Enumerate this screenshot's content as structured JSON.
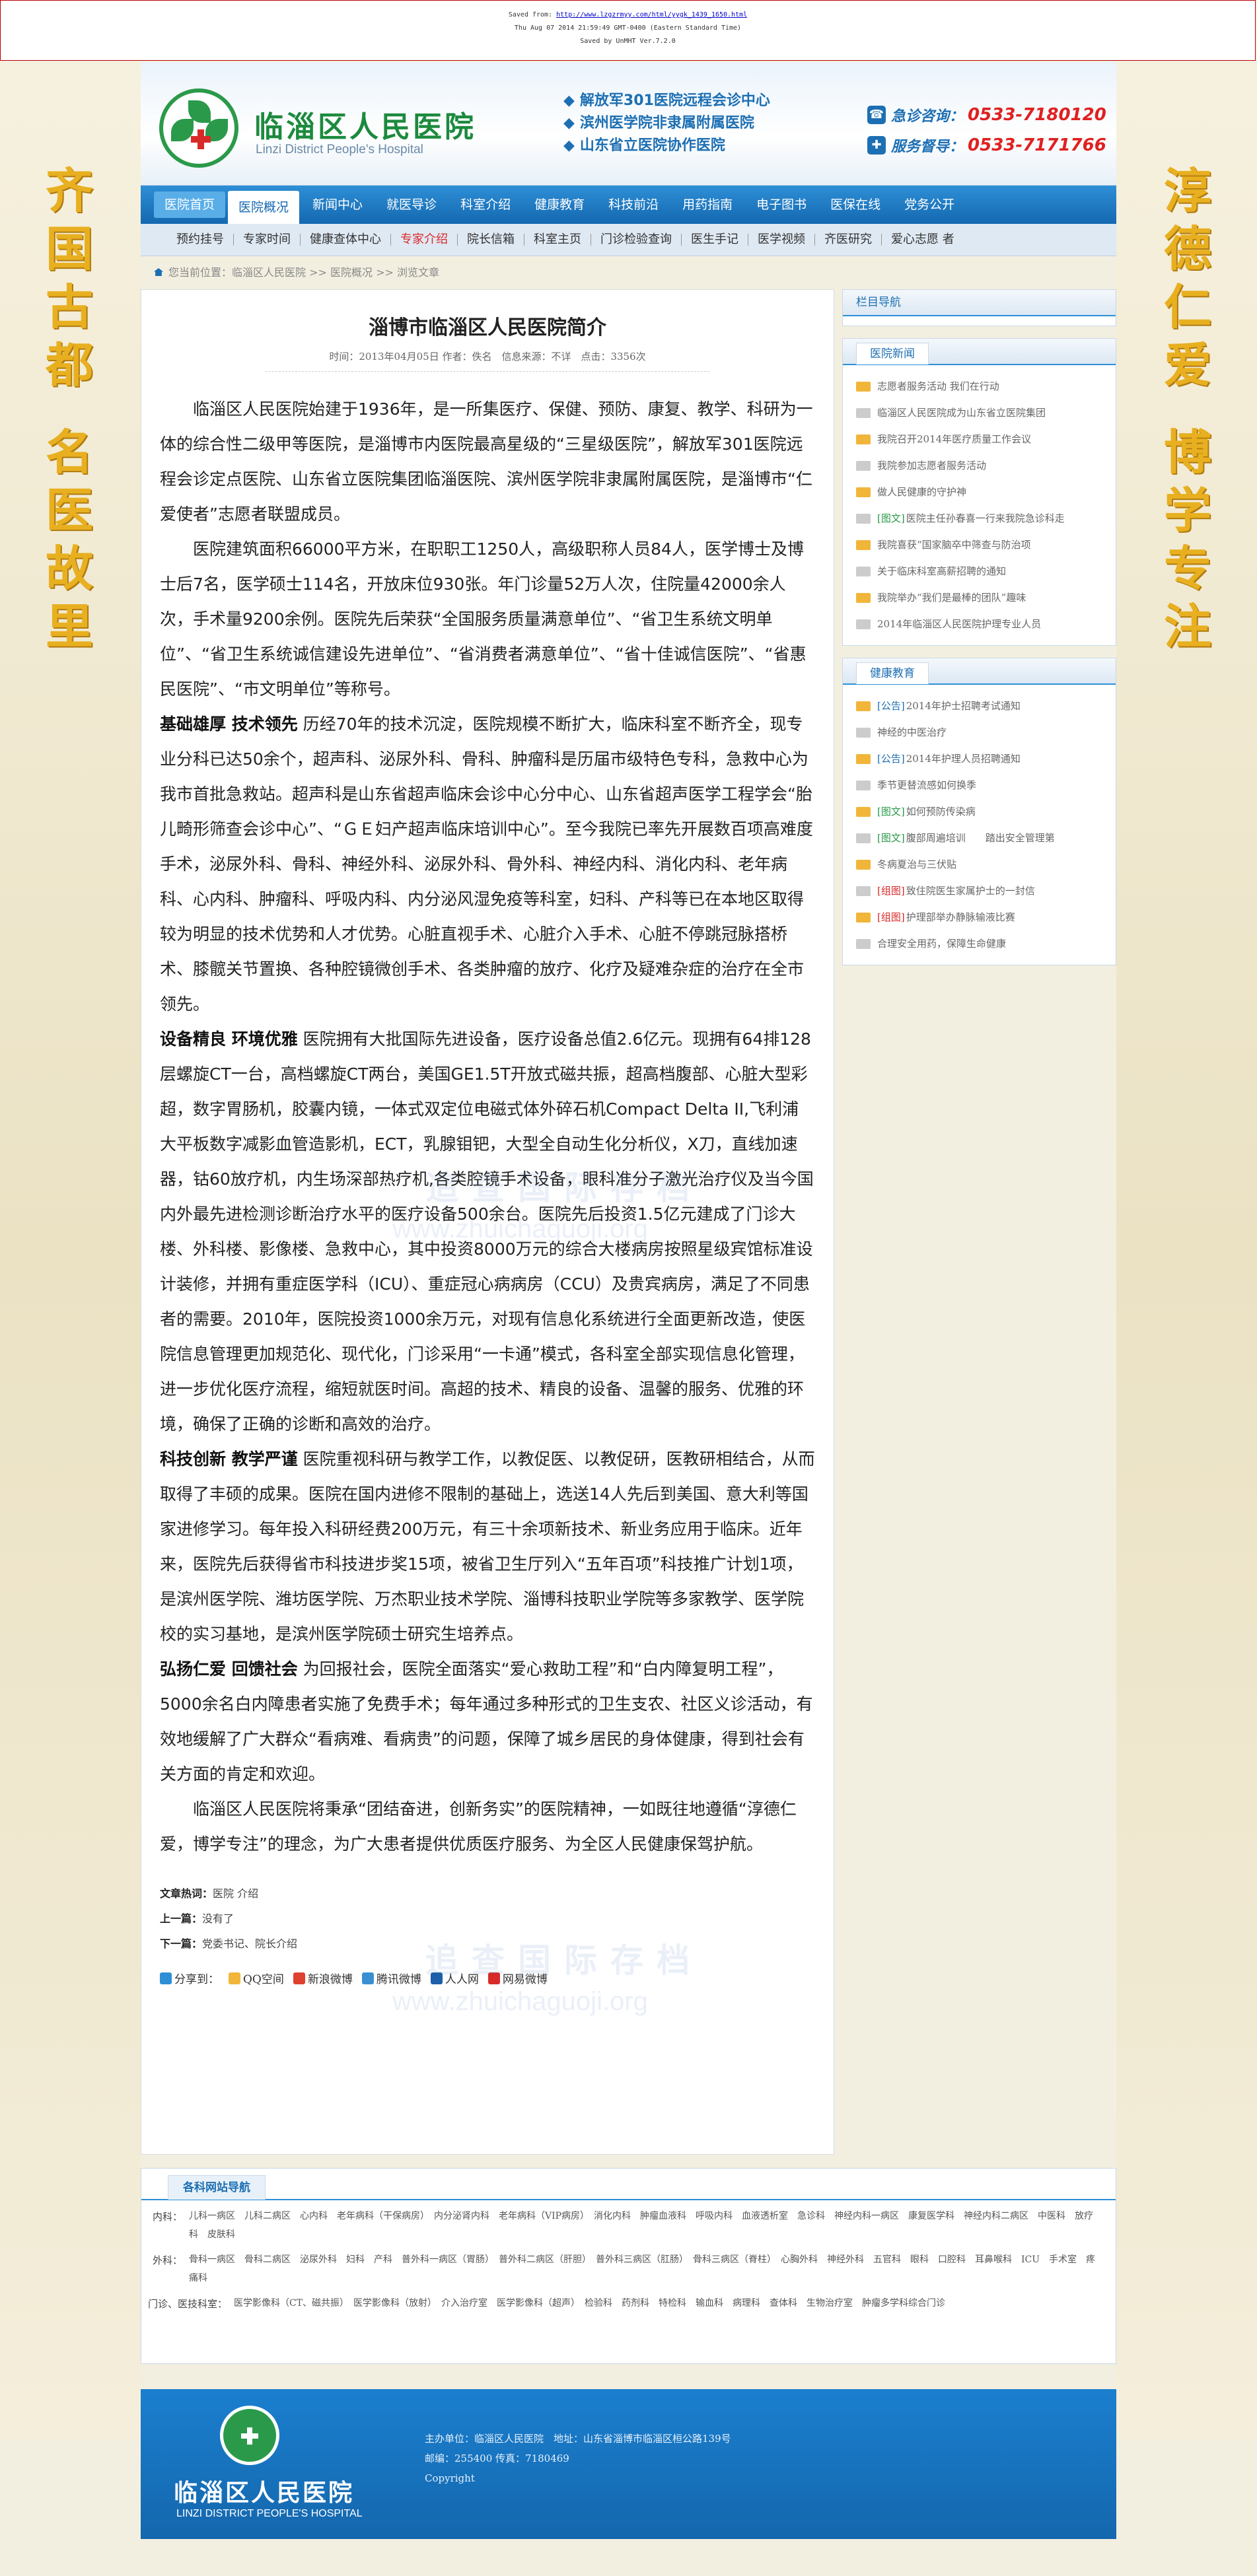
{
  "saved": {
    "line1_prefix": "Saved from",
    "line1_url": "http://www.lzgzrmyy.com/html/yygk_1439_1650.html",
    "line2": "Thu Aug 07 2014 21:59:49 GMT-0400 (Eastern Standard Time)",
    "line3": "Saved by UnMHT Ver.7.2.0"
  },
  "side": {
    "left_top": [
      "齐",
      "国",
      "古",
      "都"
    ],
    "left_bottom": [
      "名",
      "医",
      "故",
      "里"
    ],
    "right_top": [
      "淳",
      "德",
      "仁",
      "爱"
    ],
    "right_bottom": [
      "博",
      "学",
      "专",
      "注"
    ]
  },
  "header": {
    "title": "临淄区人民医院",
    "subtitle": "Linzi District People's Hospital",
    "links": [
      "解放军301医院远程会诊中心",
      "滨州医学院非隶属附属医院",
      "山东省立医院协作医院"
    ],
    "phone1_label": "急诊咨询：",
    "phone1_prefix": "0533-",
    "phone1_num": "7180120",
    "phone2_label": "服务督导：",
    "phone2_prefix": "0533-",
    "phone2_num": "7171766"
  },
  "nav1": [
    "医院首页",
    "医院概况",
    "新闻中心",
    "就医导诊",
    "科室介绍",
    "健康教育",
    "科技前沿",
    "用药指南",
    "电子图书",
    "医保在线",
    "党务公开"
  ],
  "nav2": [
    "预约挂号",
    "专家时间",
    "健康查体中心",
    "专家介绍",
    "院长信箱",
    "科室主页",
    "门诊检验查询",
    "医生手记",
    "医学视频",
    "齐医研究",
    "爱心志愿 者"
  ],
  "breadcrumb": {
    "text": "您当前位置：临淄区人民医院 >> 医院概况 >> 浏览文章"
  },
  "article": {
    "title": "淄博市临淄区人民医院简介",
    "meta": "时间：2013年04月05日 作者：佚名　信息来源：不详　点击：3356次",
    "p1": "临淄区人民医院始建于1936年，是一所集医疗、保健、预防、康复、教学、科研为一体的综合性二级甲等医院，是淄博市内医院最高星级的“三星级医院”，解放军301医院远程会诊定点医院、山东省立医院集团临淄医院、滨州医学院非隶属附属医院，是淄博市“仁爱使者”志愿者联盟成员。",
    "p2": "医院建筑面积66000平方米，在职职工1250人，高级职称人员84人，医学博士及博士后7名，医学硕士114名，开放床位930张。年门诊量52万人次，住院量42000余人次，手术量9200余例。医院先后荣获“全国服务质量满意单位”、“省卫生系统文明单位”、“省卫生系统诚信建设先进单位”、“省消费者满意单位”、“省十佳诚信医院”、“省惠民医院”、“市文明单位”等称号。",
    "h3": "基础雄厚 技术领先",
    "p3": "历经70年的技术沉淀，医院规模不断扩大，临床科室不断齐全，现专业分科已达50余个，超声科、泌尿外科、骨科、肿瘤科是历届市级特色专科，急救中心为我市首批急救站。超声科是山东省超声临床会诊中心分中心、山东省超声医学工程学会“胎儿畸形筛查会诊中心”、“ＧＥ妇产超声临床培训中心”。至今我院已率先开展数百项高难度手术，泌尿外科、骨科、神经外科、泌尿外科、骨外科、神经内科、消化内科、老年病科、心内科、肿瘤科、呼吸内科、内分泌风湿免疫等科室，妇科、产科等已在本地区取得较为明显的技术优势和人才优势。心脏直视手术、心脏介入手术、心脏不停跳冠脉搭桥术、膝髋关节置换、各种腔镜微创手术、各类肿瘤的放疗、化疗及疑难杂症的治疗在全市领先。",
    "h4": "设备精良 环境优雅",
    "p4": "医院拥有大批国际先进设备，医疗设备总值2.6亿元。现拥有64排128层螺旋CT一台，高档螺旋CT两台，美国GE1.5T开放式磁共振，超高档腹部、心脏大型彩超，数字胃肠机，胶囊内镜，一体式双定位电磁式体外碎石机Compact Delta II,飞利浦大平板数字减影血管造影机，ECT，乳腺钼钯，大型全自动生化分析仪，X刀，直线加速器，钴60放疗机，内生场深部热疗机,各类腔镜手术设备，眼科准分子激光治疗仪及当今国内外最先进检测诊断治疗水平的医疗设备500余台。医院先后投资1.5亿元建成了门诊大楼、外科楼、影像楼、急救中心，其中投资8000万元的综合大楼病房按照星级宾馆标准设计装修，并拥有重症医学科（ICU）、重症冠心病病房（CCU）及贵宾病房，满足了不同患者的需要。2010年，医院投资1000余万元，对现有信息化系统进行全面更新改造，使医院信息管理更加规范化、现代化，门诊采用“一卡通”模式，各科室全部实现信息化管理，进一步优化医疗流程，缩短就医时间。高超的技术、精良的设备、温馨的服务、优雅的环境，确保了正确的诊断和高效的治疗。",
    "h5": "科技创新 教学严谨",
    "p5": "医院重视科研与教学工作，以教促医、以教促研，医教研相结合，从而取得了丰硕的成果。医院在国内进修不限制的基础上，选送14人先后到美国、意大利等国家进修学习。每年投入科研经费200万元，有三十余项新技术、新业务应用于临床。近年来，医院先后获得省市科技进步奖15项，被省卫生厅列入“五年百项”科技推广计划1项，是滨州医学院、潍坊医学院、万杰职业技术学院、淄博科技职业学院等多家教学、医学院校的实习基地，是滨州医学院硕士研究生培养点。",
    "h6": "弘扬仁爱 回馈社会",
    "p6": "为回报社会，医院全面落实“爱心救助工程”和“白内障复明工程”，5000余名白内障患者实施了免费手术；每年通过多种形式的卫生支农、社区义诊活动，有效地缓解了广大群众“看病难、看病贵”的问题，保障了城乡居民的身体健康，得到社会有关方面的肯定和欢迎。",
    "p7": "临淄区人民医院将秉承“团结奋进，创新务实”的医院精神，一如既往地遵循“淳德仁爱，博学专注”的理念，为广大患者提供优质医疗服务、为全区人民健康保驾护航。",
    "watermark_cn": "追查国际存档",
    "watermark_url": "www.zhuichaguoji.org",
    "tags_label": "文章热词：",
    "tags": "医院 介绍",
    "prev_label": "上一篇：",
    "prev": "没有了",
    "next_label": "下一篇：",
    "next": "党委书记、院长介绍",
    "share_label": "分享到：",
    "share": [
      "QQ空间",
      "新浪微博",
      "腾讯微博",
      "人人网",
      "网易微博"
    ]
  },
  "sidebar": {
    "nav_title": "栏目导航",
    "news_title": "医院新闻",
    "news": [
      {
        "tag": "",
        "text": "志愿者服务活动 我们在行动"
      },
      {
        "tag": "",
        "text": "临淄区人民医院成为山东省立医院集团"
      },
      {
        "tag": "",
        "text": "我院召开2014年医疗质量工作会议"
      },
      {
        "tag": "",
        "text": "我院参加志愿者服务活动"
      },
      {
        "tag": "",
        "text": "做人民健康的守护神"
      },
      {
        "tag": "[图文]",
        "text": "医院主任孙春喜一行来我院急诊科走"
      },
      {
        "tag": "",
        "text": "我院喜获“国家脑卒中筛查与防治项"
      },
      {
        "tag": "",
        "text": "关于临床科室高薪招聘的通知"
      },
      {
        "tag": "",
        "text": "我院举办“我们是最棒的团队”趣味"
      },
      {
        "tag": "",
        "text": "2014年临淄区人民医院护理专业人员"
      }
    ],
    "health_title": "健康教育",
    "health": [
      {
        "tag": "[公告]",
        "text": "2014年护士招聘考试通知"
      },
      {
        "tag": "",
        "text": "神经的中医治疗"
      },
      {
        "tag": "[公告]",
        "text": "2014年护理人员招聘通知"
      },
      {
        "tag": "",
        "text": "季节更替流感如何换季"
      },
      {
        "tag": "[图文]",
        "text": "如何预防传染病"
      },
      {
        "tag": "[图文]",
        "text": "腹部周遍培训　　踏出安全管理第"
      },
      {
        "tag": "",
        "text": "冬病夏治与三伏贴"
      },
      {
        "tag": "[组图]",
        "text": "致住院医生家属护士的一封信"
      },
      {
        "tag": "[组图]",
        "text": "护理部举办静脉输液比赛"
      },
      {
        "tag": "",
        "text": "合理安全用药，保障生命健康"
      }
    ]
  },
  "depts": {
    "title": "各科网站导航",
    "rows": [
      {
        "label": "内科：",
        "items": "儿科一病区　儿科二病区　心内科　老年病科（干保病房）　内分泌肾内科　老年病科（VIP病房）　消化内科　肿瘤血液科　呼吸内科　血液透析室　急诊科　神经内科一病区　康复医学科　神经内科二病区　中医科　放疗科　皮肤科"
      },
      {
        "label": "外科：",
        "items": "骨科一病区　骨科二病区　泌尿外科　妇科　产科　普外科一病区（胃肠）　普外科二病区（肝胆）　普外科三病区（肛肠）　骨科三病区（脊柱）　心胸外科　神经外科　五官科　眼科　口腔科　耳鼻喉科　ICU　手术室　疼痛科"
      },
      {
        "label": "门诊、医技科室：",
        "items": "医学影像科（CT、磁共振）　医学影像科（放射）　介入治疗室　医学影像科（超声）　检验科　药剂科　特检科　输血科　病理科　查体科　生物治疗室　肿瘤多学科综合门诊"
      }
    ]
  },
  "footer": {
    "title": "临淄区人民医院",
    "subtitle": "LINZI DISTRICT PEOPLE'S HOSPITAL",
    "line1": "主办单位：临淄区人民医院　地址：山东省淄博市临淄区桓公路139号",
    "line2": "邮编：255400 传真：7180469",
    "line3": "Copyright"
  }
}
